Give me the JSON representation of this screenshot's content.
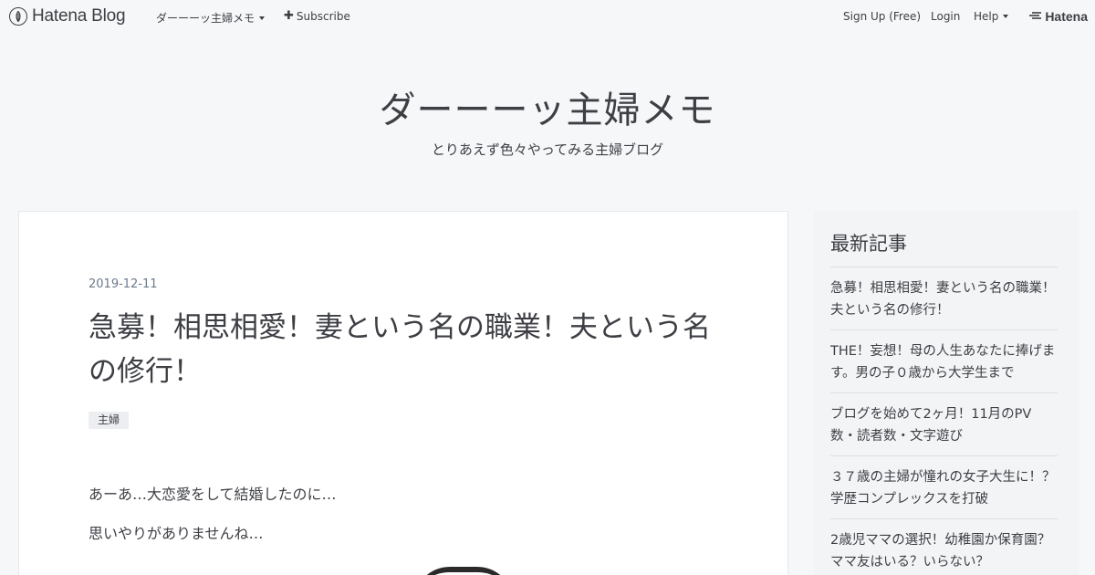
{
  "header": {
    "brand": "Hatena Blog",
    "blog_menu": "ダーーーッ主婦メモ",
    "subscribe": "Subscribe",
    "signup": "Sign Up (Free)",
    "login": "Login",
    "help": "Help",
    "hatena": "Hatena",
    "icons": {
      "brand": "hatena-blog-logo-icon",
      "hatena": "hatena-logo-icon"
    }
  },
  "blog": {
    "title": "ダーーーッ主婦メモ",
    "description": "とりあえず色々やってみる主婦ブログ"
  },
  "entry": {
    "date": "2019-12-11",
    "title": "急募！相思相愛！妻という名の職業！夫という名の修行！",
    "category": "主婦",
    "paragraphs": [
      "あーあ…大恋愛をして結婚したのに…",
      "思いやりがありませんね…"
    ]
  },
  "sidebar": {
    "recent_title": "最新記事",
    "recent_items": [
      "急募！相思相愛！妻という名の職業！夫という名の修行！",
      "THE！妄想！母の人生あなたに捧げます。男の子０歳から大学生まで",
      "ブログを始めて2ヶ月！11月のPV数・読者数・文字遊び",
      "３７歳の主婦が憧れの女子大生に！？学歴コンプレックスを打破",
      "2歳児ママの選択！幼稚園か保育園？ママ友はいる？いらない？"
    ]
  },
  "colors": {
    "background": "#f6f7f9",
    "text": "#3d3f44",
    "date": "#6b7a8c"
  }
}
